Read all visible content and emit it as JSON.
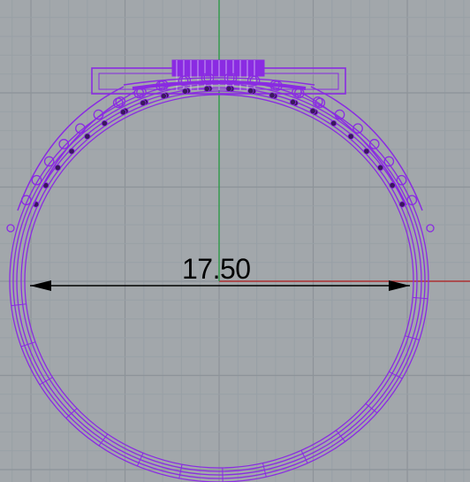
{
  "viewport": {
    "background": "#a2a7ab",
    "grid_minor_color": "#98a0a6",
    "grid_major_color": "#8d9399",
    "axis_x_color": "#b31c1c",
    "axis_y_color": "#1d9a3a",
    "wire_color": "#8a2be2"
  },
  "dimension": {
    "value_label": "17.50",
    "line_color": "#000000"
  },
  "icons": {
    "dimension_arrow": "arrowhead"
  }
}
